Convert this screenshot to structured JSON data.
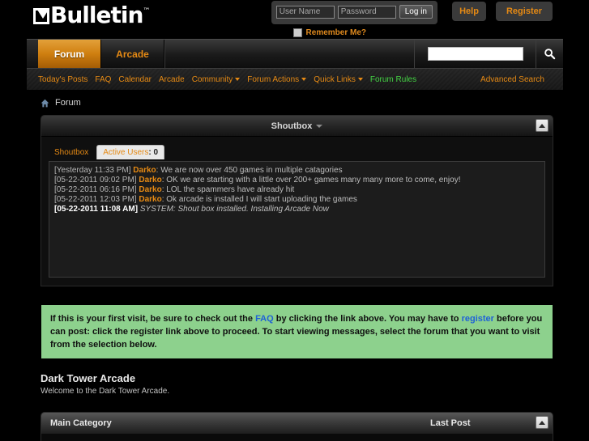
{
  "site": {
    "logo_text": "Bulletin",
    "logo_tm": "™"
  },
  "login": {
    "username_placeholder": "User Name",
    "password_placeholder": "Password",
    "username_value": "",
    "password_value": "",
    "login_label": "Log in",
    "remember_label": "Remember Me?",
    "help_label": "Help",
    "register_label": "Register"
  },
  "navtabs": [
    {
      "label": "Forum",
      "active": true
    },
    {
      "label": "Arcade",
      "active": false
    }
  ],
  "search": {
    "value": "",
    "placeholder": "",
    "icon": "magnifier-icon"
  },
  "linkbar": {
    "links": [
      {
        "label": "Today's Posts",
        "caret": false,
        "green": false
      },
      {
        "label": "FAQ",
        "caret": false,
        "green": false
      },
      {
        "label": "Calendar",
        "caret": false,
        "green": false
      },
      {
        "label": "Arcade",
        "caret": false,
        "green": false
      },
      {
        "label": "Community",
        "caret": true,
        "green": false
      },
      {
        "label": "Forum Actions",
        "caret": true,
        "green": false
      },
      {
        "label": "Quick Links",
        "caret": true,
        "green": false
      },
      {
        "label": "Forum Rules",
        "caret": false,
        "green": true
      }
    ],
    "advanced_search": "Advanced Search"
  },
  "breadcrumb": {
    "home_icon": "home-icon",
    "crumb": "Forum"
  },
  "shoutbox": {
    "panel_title": "Shoutbox",
    "tabs": [
      {
        "label": "Shoutbox",
        "active": false
      },
      {
        "label": "Active Users",
        "count": ": 0",
        "active": true
      }
    ],
    "messages": [
      {
        "timestamp": "[Yesterday 11:33 PM]",
        "user": "Darko",
        "text": ": We are now over 450 games in multiple catagories",
        "system": false
      },
      {
        "timestamp": "[05-22-2011 09:02 PM]",
        "user": "Darko",
        "text": ": OK we are starting with a little over 200+ games many many more to come, enjoy!",
        "system": false
      },
      {
        "timestamp": "[05-22-2011 06:16 PM]",
        "user": "Darko",
        "text": ": LOL the spammers have already hit",
        "system": false
      },
      {
        "timestamp": "[05-22-2011 12:03 PM]",
        "user": "Darko",
        "text": ": Ok arcade is installed I will start uploading the games",
        "system": false
      },
      {
        "timestamp": "[05-22-2011 11:08 AM]",
        "user": "",
        "text": "SYSTEM: Shout box installed. Installing Arcade Now",
        "system": true
      }
    ]
  },
  "notice": {
    "part1": "If this is your first visit, be sure to check out the ",
    "link_faq": "FAQ",
    "part2": " by clicking the link above. You may have to ",
    "link_register": "register",
    "part3": " before you can post: click the register link above to proceed. To start viewing messages, select the forum that you want to visit from the selection below."
  },
  "forum": {
    "title": "Dark Tower Arcade",
    "subtitle": "Welcome to the Dark Tower Arcade."
  },
  "category_table": {
    "col_main": "Main Category",
    "col_last_post": "Last Post"
  },
  "colors": {
    "accent_orange": "#e68a14",
    "tab_active": "#cf7f10",
    "notice_green": "#8dd18d",
    "link_blue": "#1f62d6",
    "rules_green": "#44d444",
    "background": "#000000"
  }
}
